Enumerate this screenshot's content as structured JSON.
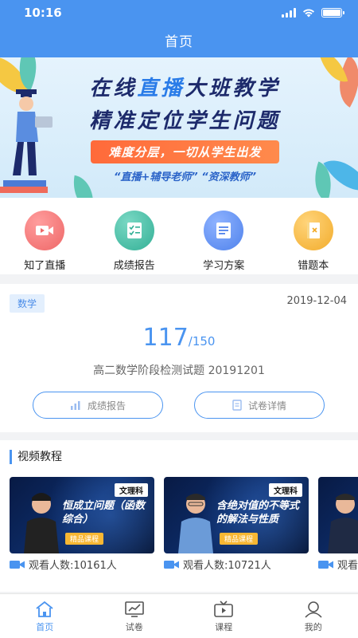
{
  "status_bar": {
    "time": "10:16"
  },
  "nav": {
    "title": "首页"
  },
  "banner": {
    "line1_a": "在线",
    "line1_highlight": "直播",
    "line1_b": "大班教学",
    "line2": "精准定位学生问题",
    "pill": "难度分层，一切从学生出发",
    "sub": "“直播+辅导老师” “资深教师”"
  },
  "quick_links": [
    {
      "label": "知了直播",
      "icon": "video-camera-icon",
      "color": "#f07a7a"
    },
    {
      "label": "成绩报告",
      "icon": "checklist-icon",
      "color": "#3fb8a0"
    },
    {
      "label": "学习方案",
      "icon": "document-icon",
      "color": "#5b8ef0"
    },
    {
      "label": "错题本",
      "icon": "error-book-icon",
      "color": "#f3b23c"
    }
  ],
  "score_card": {
    "subject": "数学",
    "date": "2019-12-04",
    "score": "117",
    "total": "/150",
    "exam_name": "高二数学阶段检测试题 20191201",
    "report_button": "成绩报告",
    "detail_button": "试卷详情"
  },
  "video_section": {
    "title": "视频教程",
    "videos": [
      {
        "tag": "文理科",
        "title": "恒成立问题（函数综合）",
        "badge": "精品课程",
        "views": "观看人数:10161人"
      },
      {
        "tag": "文理科",
        "title": "含绝对值的不等式的解法与性质",
        "badge": "精品课程",
        "views": "观看人数:10721人"
      },
      {
        "tag": "",
        "title": "",
        "badge": "",
        "views": "观看"
      }
    ]
  },
  "tabbar": {
    "tabs": [
      {
        "label": "首页",
        "icon": "home-icon",
        "active": true
      },
      {
        "label": "试卷",
        "icon": "chart-icon",
        "active": false
      },
      {
        "label": "课程",
        "icon": "tv-icon",
        "active": false
      },
      {
        "label": "我的",
        "icon": "user-icon",
        "active": false
      }
    ]
  },
  "colors": {
    "primary": "#4a94f0",
    "accent": "#ff7a45"
  }
}
